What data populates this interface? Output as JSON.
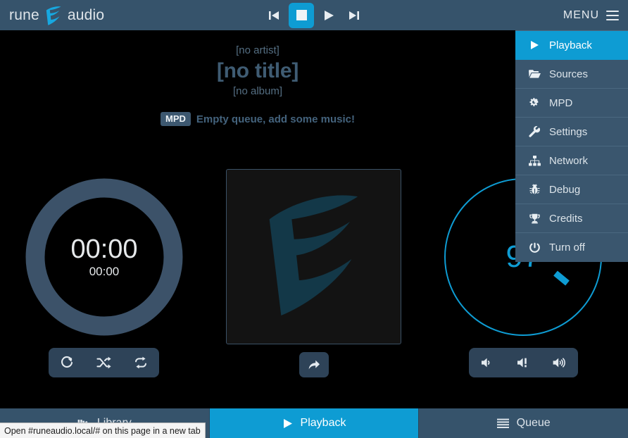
{
  "brand": {
    "word_left": "rune",
    "word_right": "audio",
    "logo_icon": "runeaudio-mask-icon"
  },
  "transport": {
    "previous_label": "Previous",
    "stop_label": "Stop",
    "play_label": "Play",
    "next_label": "Next"
  },
  "header": {
    "menu_label": "MENU",
    "menu_icon": "hamburger-icon"
  },
  "menu": {
    "items": [
      {
        "label": "Playback",
        "icon": "play-icon",
        "active": true
      },
      {
        "label": "Sources",
        "icon": "folder-open-icon",
        "active": false
      },
      {
        "label": "MPD",
        "icon": "gears-icon",
        "active": false
      },
      {
        "label": "Settings",
        "icon": "wrench-icon",
        "active": false
      },
      {
        "label": "Network",
        "icon": "sitemap-icon",
        "active": false
      },
      {
        "label": "Debug",
        "icon": "bug-icon",
        "active": false
      },
      {
        "label": "Credits",
        "icon": "trophy-icon",
        "active": false
      },
      {
        "label": "Turn off",
        "icon": "power-icon",
        "active": false
      }
    ]
  },
  "now_playing": {
    "artist": "[no artist]",
    "title": "[no title]",
    "album": "[no album]",
    "notification_badge": "MPD",
    "notification_text": "Empty queue, add some music!"
  },
  "time_knob": {
    "elapsed": "00:00",
    "total": "00:00",
    "progress_percent": 0,
    "ring_color": "#3c5269",
    "track_color": "#3c5269"
  },
  "playback_buttons": [
    {
      "label": "Repeat one",
      "icon": "repeat-one-icon"
    },
    {
      "label": "Random",
      "icon": "shuffle-icon"
    },
    {
      "label": "Repeat",
      "icon": "repeat-icon"
    }
  ],
  "album_art": {
    "alt": "No cover art",
    "watermark_icon": "runeaudio-mask-icon",
    "share_button_label": "Share",
    "share_button_icon": "share-arrow-icon"
  },
  "volume_knob": {
    "value": "97",
    "max": 100,
    "ring_color": "#0e9cd3",
    "pointer_color": "#0e9cd3"
  },
  "volume_buttons": [
    {
      "label": "Volume down",
      "icon": "volume-down-icon"
    },
    {
      "label": "Mute",
      "icon": "volume-mute-icon"
    },
    {
      "label": "Volume up",
      "icon": "volume-up-icon"
    }
  ],
  "tabs": [
    {
      "label": "Library",
      "icon": "library-icon",
      "active": false
    },
    {
      "label": "Playback",
      "icon": "play-icon",
      "active": true
    },
    {
      "label": "Queue",
      "icon": "list-icon",
      "active": false
    }
  ],
  "browser_status": {
    "text": "Open #runeaudio.local/# on this page in a new tab"
  },
  "colors": {
    "accent": "#0e9cd3",
    "header_bg": "#36536b",
    "menu_bg": "#3a566e",
    "page_bg": "#000000",
    "muted_text": "#546e82"
  }
}
